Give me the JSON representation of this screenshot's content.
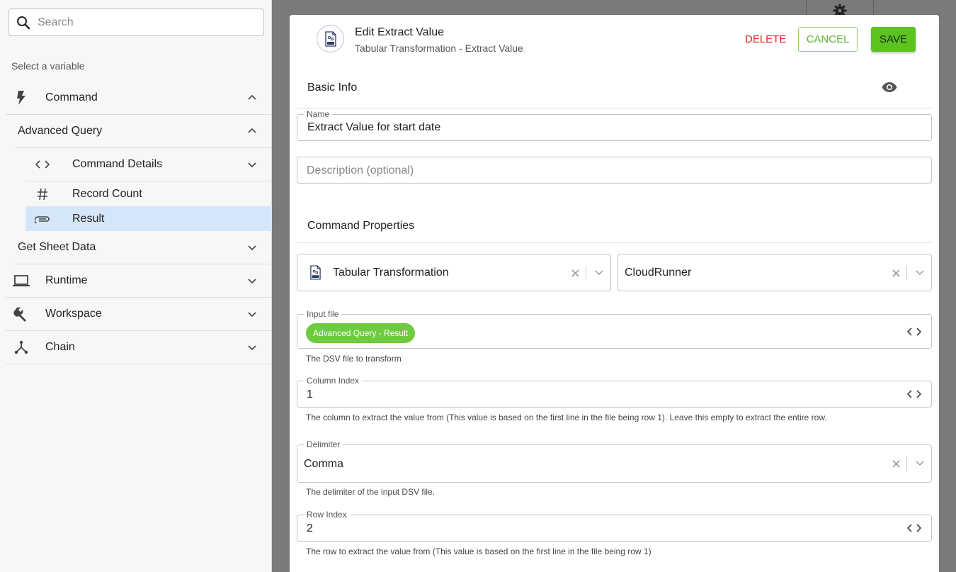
{
  "search": {
    "placeholder": "Search"
  },
  "sidebar": {
    "select_label": "Select a variable",
    "items": {
      "command": "Command",
      "advanced_query": "Advanced Query",
      "command_details": "Command Details",
      "record_count": "Record Count",
      "result": "Result",
      "get_sheet_data": "Get Sheet Data",
      "runtime": "Runtime",
      "workspace": "Workspace",
      "chain": "Chain"
    }
  },
  "modal": {
    "title": "Edit Extract Value",
    "subtitle": "Tabular Transformation - Extract Value",
    "delete_label": "DELETE",
    "cancel_label": "CANCEL",
    "save_label": "SAVE",
    "basic_info": "Basic Info",
    "name": {
      "label": "Name",
      "value": "Extract Value for start date"
    },
    "description": {
      "placeholder": "Description (optional)"
    },
    "command_properties": "Command Properties",
    "command_select": {
      "value": "Tabular Transformation"
    },
    "runner_select": {
      "value": "CloudRunner"
    },
    "input_file": {
      "label": "Input file",
      "chip": "Advanced Query - Result",
      "helper": "The DSV file to transform"
    },
    "column_index": {
      "label": "Column Index",
      "value": "1",
      "helper": "The column to extract the value from (This value is based on the first line in the file being row 1). Leave this empty to extract the entire row."
    },
    "delimiter": {
      "label": "Delimiter",
      "value": "Comma",
      "helper": "The delimiter of the input DSV file."
    },
    "row_index": {
      "label": "Row Index",
      "value": "2",
      "helper": "The row to extract the value from (This value is based on the first line in the file being row 1)"
    }
  },
  "colors": {
    "accent_green": "#5cc31f",
    "delete_red": "#e52222",
    "selected_row": "#d6e6f9"
  }
}
